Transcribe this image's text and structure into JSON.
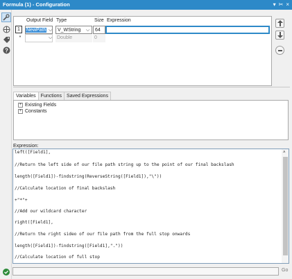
{
  "window": {
    "title": "Formula (1) - Configuration",
    "controls": [
      "▾",
      "✂",
      "×"
    ]
  },
  "grid": {
    "headers": [
      "Output Field",
      "Type",
      "Size",
      "Expression"
    ],
    "rows": [
      {
        "indicator": "1",
        "field": "NewPath",
        "type": "V_WString",
        "size": "64",
        "expression": ""
      },
      {
        "indicator": "*",
        "field": "",
        "type": "Double",
        "size": "0",
        "expression": ""
      }
    ]
  },
  "tabs": [
    "Variables",
    "Functions",
    "Saved Expressions"
  ],
  "tree": [
    {
      "label": "Existing Fields"
    },
    {
      "label": "Constants"
    }
  ],
  "expression_label": "Expression:",
  "expression_lines": [
    "left([Field1],",
    "//Return the left side of our file path string up to the point of our final backslash",
    "length([Field1])-findstring(ReverseString([Field1]),\"\\\"))",
    "//Calculate location of final backslash",
    "+\"*\"+",
    "//Add our wildcard character",
    "right([Field1],",
    "//Return the right sideo of our file path from the full stop onwards",
    "length([Field1])-findstring([Field1],\".\"))",
    "//Calculate location of full stop"
  ],
  "go_label": "Go",
  "icons": {
    "wrench": "wrench-icon",
    "arrows": "crosshair-icon",
    "tag": "tag-icon",
    "help": "help-icon",
    "up": "arrow-up-icon",
    "down": "arrow-down-icon",
    "remove": "minus-icon",
    "ok": "check-icon"
  },
  "colors": {
    "titlebar": "#2d89c8",
    "selection": "#3b8fd8",
    "okgreen": "#2e8b3a"
  }
}
